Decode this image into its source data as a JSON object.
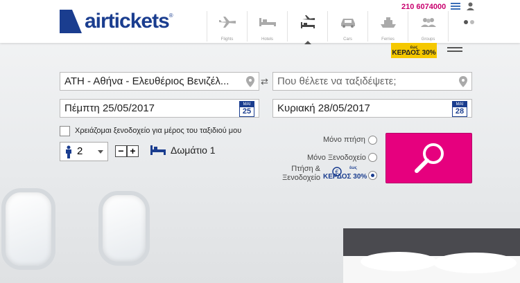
{
  "header": {
    "logo_text": "airtickets",
    "logo_reg": "®",
    "phone": "210 6074000",
    "nav": [
      {
        "label": "Flights",
        "icon": "plane-icon"
      },
      {
        "label": "Hotels",
        "icon": "bed-icon"
      },
      {
        "label": "",
        "icon": "plane-bed-icon",
        "active": true
      },
      {
        "label": "Cars",
        "icon": "car-icon"
      },
      {
        "label": "Ferries",
        "icon": "ferry-icon"
      },
      {
        "label": "Groups",
        "icon": "group-icon"
      },
      {
        "label": "",
        "icon": "more-icon"
      }
    ],
    "kerdos_badge": {
      "top": "έως",
      "text": "ΚΕΡΔΟΣ 30%"
    }
  },
  "form": {
    "from_value": "ΑΤΗ - Αθήνα - Ελευθέριος Βενιζέλ...",
    "to_placeholder": "Που θέλετε να ταξιδέψετε;",
    "depart_date": "Πέμπτη 25/05/2017",
    "depart_cal": {
      "month": "ΜΑΙ",
      "day": "25"
    },
    "return_date": "Κυριακή 28/05/2017",
    "return_cal": {
      "month": "ΜΑΙ",
      "day": "28"
    },
    "hotel_checkbox_label": "Χρειάζομαι ξενοδοχείο για μέρος του ταξιδιού μου",
    "passengers": "2",
    "room_label": "Δωμάτιο",
    "room_count": "1",
    "options": [
      {
        "label": "Μόνο πτήση",
        "selected": false
      },
      {
        "label": "Μόνο Ξενοδοχείο",
        "selected": false
      },
      {
        "label": "Πτήση & Ξενοδοχείο",
        "selected": true
      }
    ],
    "promo_top": "έως",
    "promo_text": "ΚΕΡΔΟΣ 30%"
  },
  "colors": {
    "brand": "#1a3d8f",
    "accent": "#e6007e",
    "badge": "#f5c800"
  }
}
